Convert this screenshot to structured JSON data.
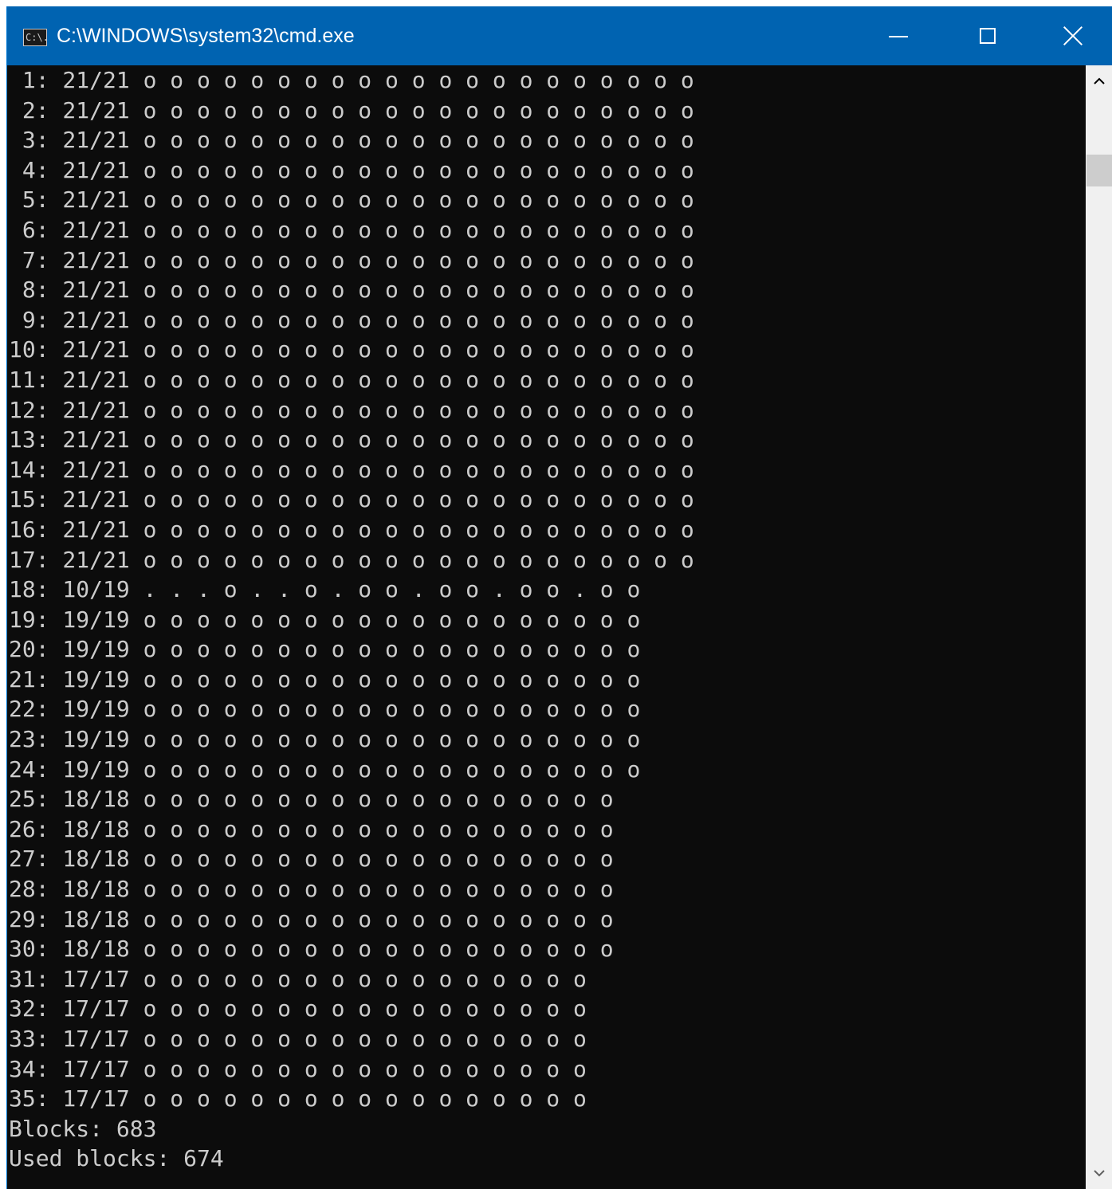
{
  "window": {
    "title": "C:\\WINDOWS\\system32\\cmd.exe",
    "icon_label": "C:\\.",
    "icon": "cmd-icon",
    "controls": {
      "minimize": "minimize-icon",
      "maximize": "maximize-icon",
      "close": "close-icon"
    }
  },
  "colors": {
    "titlebar": "#0063b1",
    "console_bg": "#0c0c0c",
    "console_fg": "#cccccc",
    "scrollbar": "#f0f0f0"
  },
  "console": {
    "lines": [
      " 1: 21/21 o o o o o o o o o o o o o o o o o o o o o",
      " 2: 21/21 o o o o o o o o o o o o o o o o o o o o o",
      " 3: 21/21 o o o o o o o o o o o o o o o o o o o o o",
      " 4: 21/21 o o o o o o o o o o o o o o o o o o o o o",
      " 5: 21/21 o o o o o o o o o o o o o o o o o o o o o",
      " 6: 21/21 o o o o o o o o o o o o o o o o o o o o o",
      " 7: 21/21 o o o o o o o o o o o o o o o o o o o o o",
      " 8: 21/21 o o o o o o o o o o o o o o o o o o o o o",
      " 9: 21/21 o o o o o o o o o o o o o o o o o o o o o",
      "10: 21/21 o o o o o o o o o o o o o o o o o o o o o",
      "11: 21/21 o o o o o o o o o o o o o o o o o o o o o",
      "12: 21/21 o o o o o o o o o o o o o o o o o o o o o",
      "13: 21/21 o o o o o o o o o o o o o o o o o o o o o",
      "14: 21/21 o o o o o o o o o o o o o o o o o o o o o",
      "15: 21/21 o o o o o o o o o o o o o o o o o o o o o",
      "16: 21/21 o o o o o o o o o o o o o o o o o o o o o",
      "17: 21/21 o o o o o o o o o o o o o o o o o o o o o",
      "18: 10/19 . . . o . . o . o o . o o . o o . o o",
      "19: 19/19 o o o o o o o o o o o o o o o o o o o",
      "20: 19/19 o o o o o o o o o o o o o o o o o o o",
      "21: 19/19 o o o o o o o o o o o o o o o o o o o",
      "22: 19/19 o o o o o o o o o o o o o o o o o o o",
      "23: 19/19 o o o o o o o o o o o o o o o o o o o",
      "24: 19/19 o o o o o o o o o o o o o o o o o o o",
      "25: 18/18 o o o o o o o o o o o o o o o o o o",
      "26: 18/18 o o o o o o o o o o o o o o o o o o",
      "27: 18/18 o o o o o o o o o o o o o o o o o o",
      "28: 18/18 o o o o o o o o o o o o o o o o o o",
      "29: 18/18 o o o o o o o o o o o o o o o o o o",
      "30: 18/18 o o o o o o o o o o o o o o o o o o",
      "31: 17/17 o o o o o o o o o o o o o o o o o",
      "32: 17/17 o o o o o o o o o o o o o o o o o",
      "33: 17/17 o o o o o o o o o o o o o o o o o",
      "34: 17/17 o o o o o o o o o o o o o o o o o",
      "35: 17/17 o o o o o o o o o o o o o o o o o",
      "Blocks: 683",
      "Used blocks: 674"
    ]
  },
  "scrollbar": {
    "up": "chevron-up-icon",
    "down": "chevron-down-icon"
  }
}
